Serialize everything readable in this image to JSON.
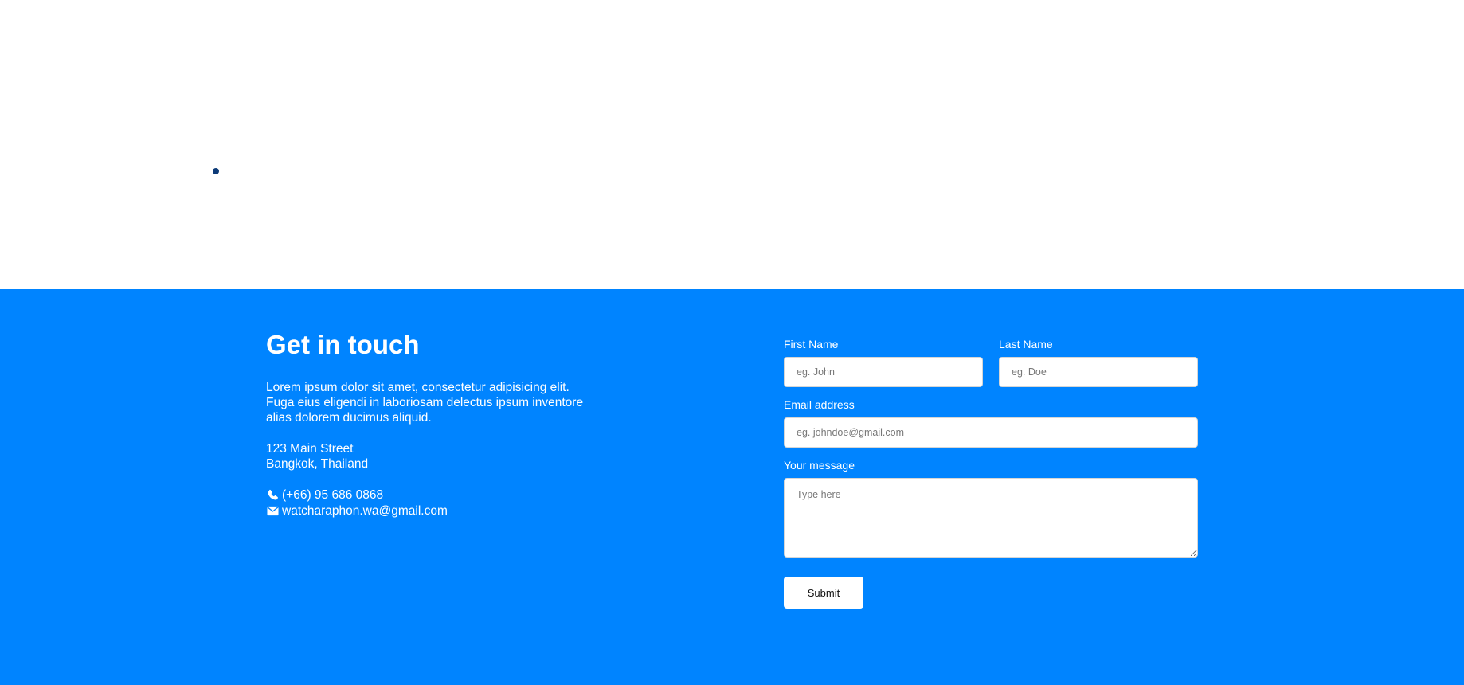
{
  "contact": {
    "heading": "Get in touch",
    "intro": "Lorem ipsum dolor sit amet, consectetur adipisicing elit. Fuga eius eligendi in laboriosam delectus ipsum inventore alias dolorem ducimus aliquid.",
    "address_line1": "123 Main Street",
    "address_line2": "Bangkok, Thailand",
    "phone": "(+66) 95 686 0868",
    "email": "watcharaphon.wa@gmail.com",
    "phone_icon": "phone-icon",
    "email_icon": "envelope-icon"
  },
  "form": {
    "first_name_label": "First Name",
    "first_name_placeholder": "eg. John",
    "last_name_label": "Last Name",
    "last_name_placeholder": "eg. Doe",
    "email_label": "Email address",
    "email_placeholder": "eg. johndoe@gmail.com",
    "message_label": "Your message",
    "message_placeholder": "Type here",
    "submit_label": "Submit"
  },
  "colors": {
    "section_bg": "#0084ff",
    "dot": "#0d3b78",
    "text": "#ffffff"
  }
}
